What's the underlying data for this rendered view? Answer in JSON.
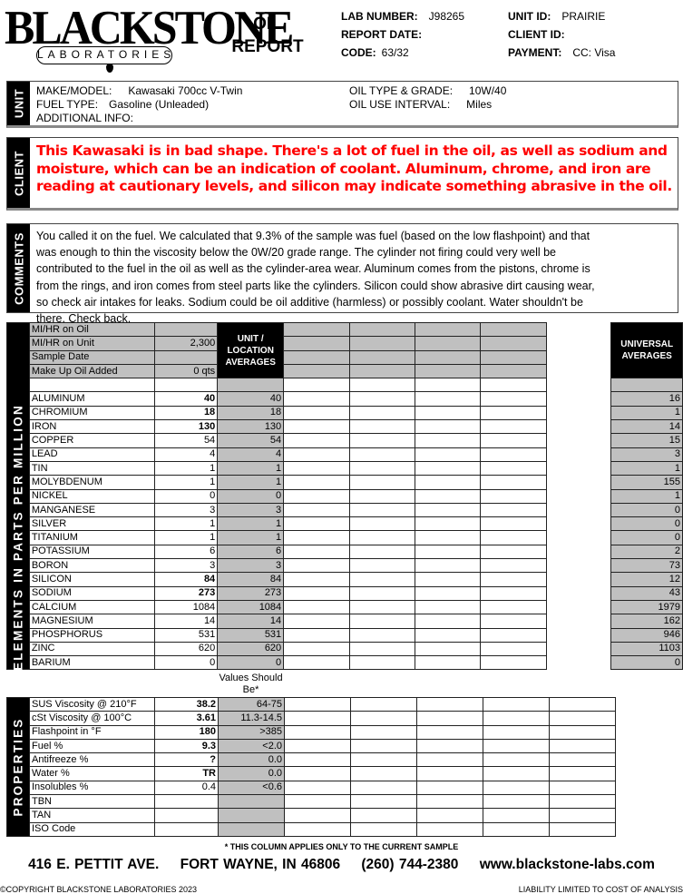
{
  "header": {
    "logo_word": "BLACKSTONE",
    "logo_sub": "LABORATORIES",
    "title_line1": "OIL",
    "title_line2": "REPORT",
    "lab_number_label": "LAB NUMBER:",
    "lab_number": "J98265",
    "report_date_label": "REPORT DATE:",
    "report_date": "",
    "code_label": "CODE:",
    "code": "63/32",
    "unit_id_label": "UNIT ID:",
    "unit_id": "PRAIRIE",
    "client_id_label": "CLIENT ID:",
    "client_id": "",
    "payment_label": "PAYMENT:",
    "payment": "CC: Visa"
  },
  "unit": {
    "side_label": "UNIT",
    "make_model_label": "MAKE/MODEL:",
    "make_model": "Kawasaki 700cc V-Twin",
    "fuel_type_label": "FUEL TYPE:",
    "fuel_type": "Gasoline (Unleaded)",
    "additional_info_label": "ADDITIONAL INFO:",
    "additional_info": "",
    "oil_type_label": "OIL TYPE & GRADE:",
    "oil_type": "10W/40",
    "oil_interval_label": "OIL USE INTERVAL:",
    "oil_interval": "Miles"
  },
  "client": {
    "side_label": "CLIENT",
    "text": "This Kawasaki is in bad shape. There's a lot of fuel in the oil, as well as sodium and moisture, which can be an indication of coolant. Aluminum, chrome, and iron are reading at cautionary levels, and silicon may indicate something abrasive in the oil."
  },
  "comments": {
    "side_label": "COMMENTS",
    "text": "You called it on the fuel. We calculated that 9.3% of the sample was fuel (based on the low flashpoint) and that was enough to thin the viscosity below the 0W/20 grade range. The cylinder not firing could very well be contributed to the fuel in the oil as well as the cylinder-area wear. Aluminum comes from the pistons, chrome is from the rings, and iron comes from steel parts like the cylinders. Silicon could show abrasive dirt causing wear, so check air intakes for leaks. Sodium could be oil additive (harmless) or possibly coolant. Water shouldn't be there. Check back."
  },
  "sample_info": {
    "unit_averages_header": "UNIT / LOCATION AVERAGES",
    "universal_averages_header": "UNIVERSAL AVERAGES",
    "rows": [
      {
        "label": "MI/HR on Oil",
        "value": ""
      },
      {
        "label": "MI/HR on Unit",
        "value": "2,300"
      },
      {
        "label": "Sample Date",
        "value": ""
      },
      {
        "label": "Make Up Oil Added",
        "value": "0 qts"
      }
    ]
  },
  "elements": {
    "side_label": "ELEMENTS IN PARTS PER MILLION",
    "rows": [
      {
        "name": "ALUMINUM",
        "value": "40",
        "bold": true,
        "unit_avg": "40",
        "universal": "16"
      },
      {
        "name": "CHROMIUM",
        "value": "18",
        "bold": true,
        "unit_avg": "18",
        "universal": "1"
      },
      {
        "name": "IRON",
        "value": "130",
        "bold": true,
        "unit_avg": "130",
        "universal": "14"
      },
      {
        "name": "COPPER",
        "value": "54",
        "bold": false,
        "unit_avg": "54",
        "universal": "15"
      },
      {
        "name": "LEAD",
        "value": "4",
        "bold": false,
        "unit_avg": "4",
        "universal": "3"
      },
      {
        "name": "TIN",
        "value": "1",
        "bold": false,
        "unit_avg": "1",
        "universal": "1"
      },
      {
        "name": "MOLYBDENUM",
        "value": "1",
        "bold": false,
        "unit_avg": "1",
        "universal": "155"
      },
      {
        "name": "NICKEL",
        "value": "0",
        "bold": false,
        "unit_avg": "0",
        "universal": "1"
      },
      {
        "name": "MANGANESE",
        "value": "3",
        "bold": false,
        "unit_avg": "3",
        "universal": "0"
      },
      {
        "name": "SILVER",
        "value": "1",
        "bold": false,
        "unit_avg": "1",
        "universal": "0"
      },
      {
        "name": "TITANIUM",
        "value": "1",
        "bold": false,
        "unit_avg": "1",
        "universal": "0"
      },
      {
        "name": "POTASSIUM",
        "value": "6",
        "bold": false,
        "unit_avg": "6",
        "universal": "2"
      },
      {
        "name": "BORON",
        "value": "3",
        "bold": false,
        "unit_avg": "3",
        "universal": "73"
      },
      {
        "name": "SILICON",
        "value": "84",
        "bold": true,
        "unit_avg": "84",
        "universal": "12"
      },
      {
        "name": "SODIUM",
        "value": "273",
        "bold": true,
        "unit_avg": "273",
        "universal": "43"
      },
      {
        "name": "CALCIUM",
        "value": "1084",
        "bold": false,
        "unit_avg": "1084",
        "universal": "1979"
      },
      {
        "name": "MAGNESIUM",
        "value": "14",
        "bold": false,
        "unit_avg": "14",
        "universal": "162"
      },
      {
        "name": "PHOSPHORUS",
        "value": "531",
        "bold": false,
        "unit_avg": "531",
        "universal": "946"
      },
      {
        "name": "ZINC",
        "value": "620",
        "bold": false,
        "unit_avg": "620",
        "universal": "1103"
      },
      {
        "name": "BARIUM",
        "value": "0",
        "bold": false,
        "unit_avg": "0",
        "universal": "0"
      }
    ]
  },
  "properties": {
    "side_label": "PROPERTIES",
    "should_be_header": "Values Should Be*",
    "rows": [
      {
        "name": "SUS Viscosity @ 210°F",
        "value": "38.2",
        "bold": true,
        "should_be": "64-75"
      },
      {
        "name": "cSt Viscosity @ 100°C",
        "value": "3.61",
        "bold": true,
        "should_be": "11.3-14.5"
      },
      {
        "name": "Flashpoint in °F",
        "value": "180",
        "bold": true,
        "should_be": ">385"
      },
      {
        "name": "Fuel %",
        "value": "9.3",
        "bold": true,
        "should_be": "<2.0"
      },
      {
        "name": "Antifreeze %",
        "value": "?",
        "bold": true,
        "should_be": "0.0"
      },
      {
        "name": "Water %",
        "value": "TR",
        "bold": true,
        "should_be": "0.0"
      },
      {
        "name": "Insolubles %",
        "value": "0.4",
        "bold": false,
        "should_be": "<0.6"
      },
      {
        "name": "TBN",
        "value": "",
        "bold": false,
        "should_be": ""
      },
      {
        "name": "TAN",
        "value": "",
        "bold": false,
        "should_be": ""
      },
      {
        "name": "ISO Code",
        "value": "",
        "bold": false,
        "should_be": ""
      }
    ]
  },
  "footer": {
    "footnote": "* THIS COLUMN APPLIES ONLY TO THE CURRENT SAMPLE",
    "street": "416 E. PETTIT AVE.",
    "city": "FORT WAYNE, IN  46806",
    "phone": "(260) 744-2380",
    "website": "www.blackstone-labs.com",
    "copyright": "©COPYRIGHT BLACKSTONE LABORATORIES  2023",
    "liability": "LIABILITY LIMITED TO COST OF ANALYSIS"
  }
}
